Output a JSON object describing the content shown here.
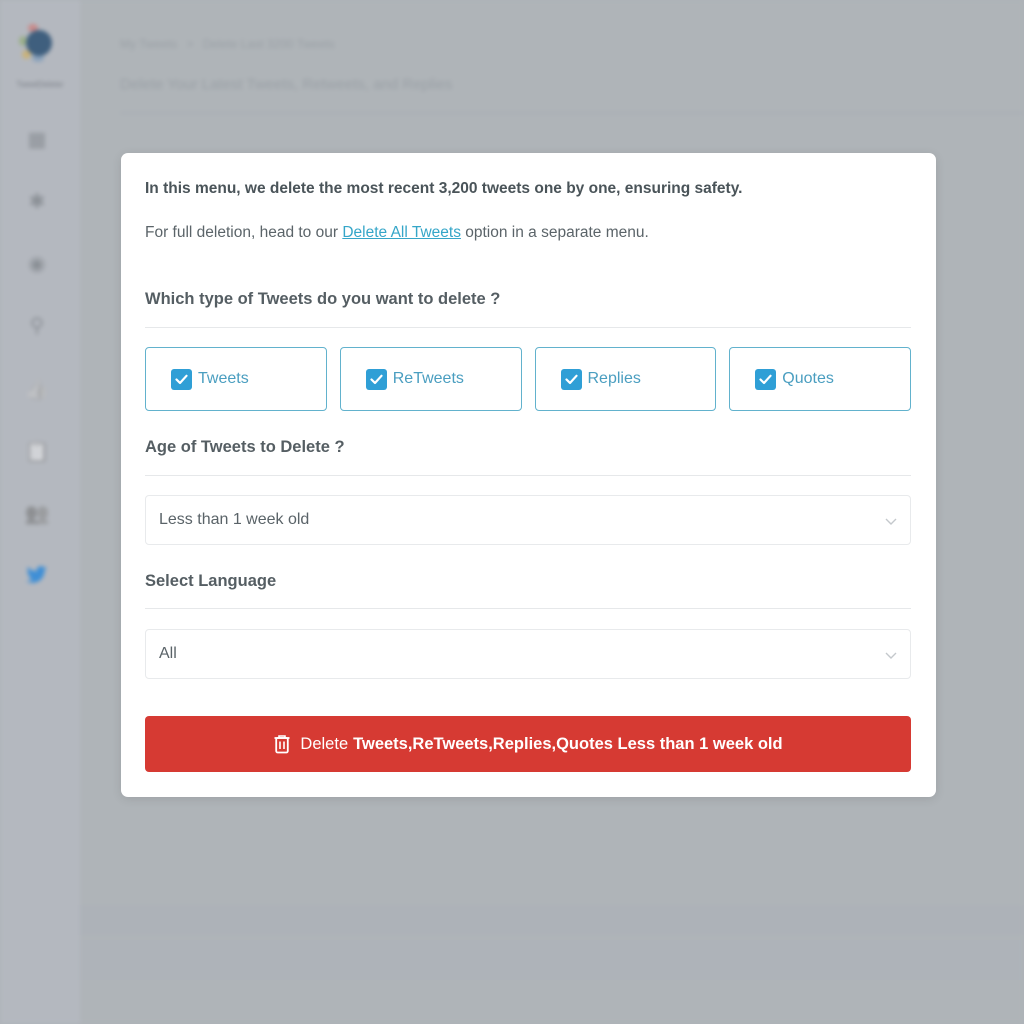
{
  "app": {
    "logo_text": "TweetDeleter",
    "breadcrumb": [
      "My Tweets",
      "Delete Last 3200 Tweets"
    ],
    "breadcrumb_separator": ">",
    "page_title": "Delete Your Latest Tweets, Retweets, and Replies",
    "sidebar": {
      "items": [
        {
          "icon": "dashboard-grid-icon",
          "glyph": "▦"
        },
        {
          "icon": "asterisk-icon",
          "glyph": "✱"
        },
        {
          "icon": "target-circle-icon",
          "glyph": "◉"
        },
        {
          "icon": "search-icon",
          "glyph": "⚲"
        },
        {
          "icon": "like-icon",
          "glyph": "👍"
        },
        {
          "icon": "clipboard-icon",
          "glyph": "📋"
        },
        {
          "icon": "users-icon",
          "glyph": "👥"
        },
        {
          "icon": "twitter-bird-icon",
          "glyph": "🐦"
        }
      ]
    }
  },
  "modal": {
    "intro_bold": "In this menu, we delete the most recent 3,200 tweets one by one, ensuring safety.",
    "intro_prefix": "For full deletion, head to our ",
    "intro_link": "Delete All Tweets",
    "intro_suffix": " option in a separate menu.",
    "types_title": "Which type of Tweets do you want to delete ?",
    "types": [
      {
        "label": "Tweets",
        "checked": true
      },
      {
        "label": "ReTweets",
        "checked": true
      },
      {
        "label": "Replies",
        "checked": true
      },
      {
        "label": "Quotes",
        "checked": true
      }
    ],
    "age_title": "Age of Tweets to Delete ?",
    "age_value": "Less than 1 week old",
    "language_title": "Select Language",
    "language_value": "All",
    "delete_button": {
      "prefix": "Delete",
      "bold": "Tweets,ReTweets,Replies,Quotes Less than 1 week old"
    }
  },
  "colors": {
    "accent": "#2f9fd6",
    "link": "#35a6c8",
    "danger": "#d63a33",
    "box_border": "#62b2cd"
  }
}
